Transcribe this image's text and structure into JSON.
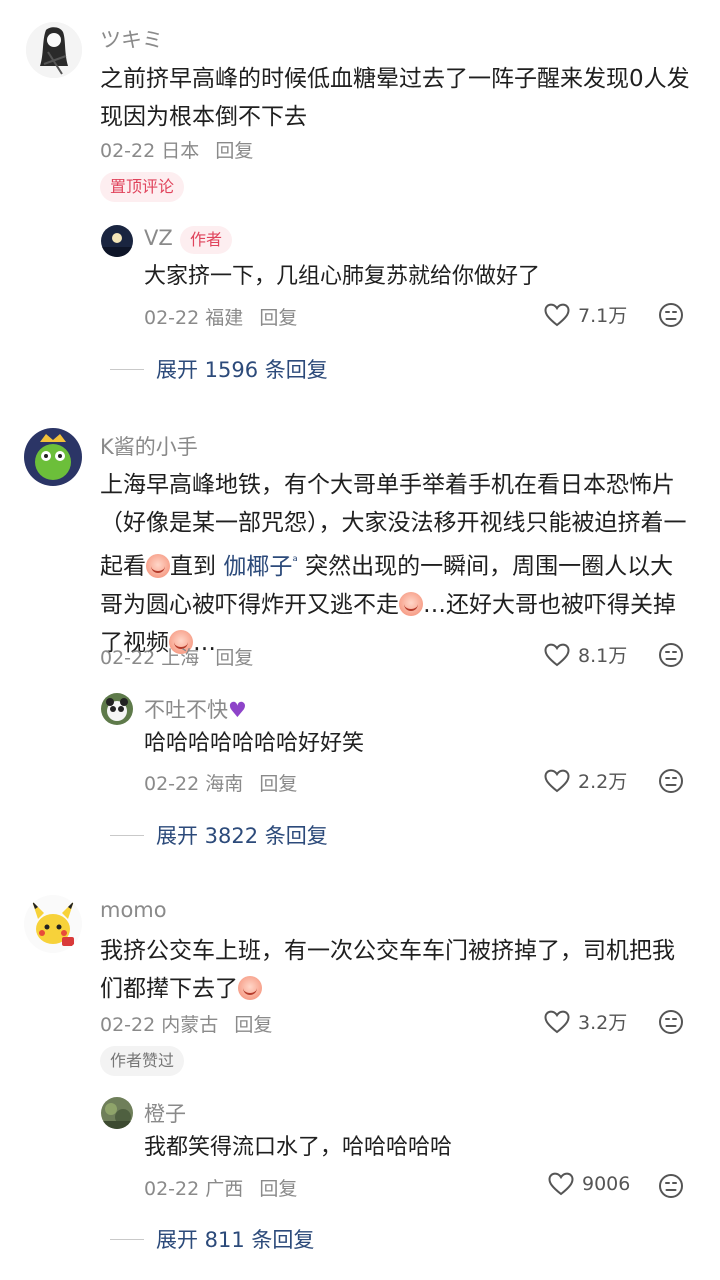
{
  "threads": [
    {
      "user": "ツキミ",
      "text": "之前挤早高峰的时候低血糖晕过去了一阵子醒来发现0人发现因为根本倒不下去",
      "date": "02-22",
      "location": "日本",
      "reply_label": "回复",
      "pin_tag": "置顶评论",
      "reply": {
        "user": "VZ",
        "author_tag": "作者",
        "text": "大家挤一下，几组心肺复苏就给你做好了",
        "date": "02-22",
        "location": "福建",
        "reply_label": "回复",
        "likes": "7.1万"
      },
      "expand": "展开 1596 条回复"
    },
    {
      "user": "K酱的小手",
      "text_part1": "上海早高峰地铁，有个大哥单手举着手机在看日本恐怖片（好像是某一部咒怨），大家没法移开视线只能被迫挤着一起看",
      "text_part2": "直到 ",
      "mention": "伽椰子",
      "text_part3": " 突然出现的一瞬间，周围一圈人以大哥为圆心被吓得炸开又逃不走",
      "text_part4": "…还好大哥也被吓得关掉了视频",
      "text_part5": "…",
      "date": "02-22",
      "location": "上海",
      "reply_label": "回复",
      "likes": "8.1万",
      "reply": {
        "user": "不吐不快",
        "text": "哈哈哈哈哈哈哈好好笑",
        "date": "02-22",
        "location": "海南",
        "reply_label": "回复",
        "likes": "2.2万"
      },
      "expand": "展开 3822 条回复"
    },
    {
      "user": "momo",
      "text": "我挤公交车上班，有一次公交车车门被挤掉了，司机把我们都撵下去了",
      "date": "02-22",
      "location": "内蒙古",
      "reply_label": "回复",
      "likes": "3.2万",
      "liked_tag": "作者赞过",
      "reply": {
        "user": "橙子",
        "text": "我都笑得流口水了，哈哈哈哈哈",
        "date": "02-22",
        "location": "广西",
        "reply_label": "回复",
        "likes": "9006"
      },
      "expand": "展开 811 条回复"
    }
  ],
  "icons": {
    "like": "heart-outline-icon",
    "dislike": "dislike-face-icon",
    "emoji": "crying-emoji-icon",
    "mention_marker": "search-link-icon",
    "heart": "purple-heart-icon"
  },
  "colors": {
    "link": "#2c4a7a",
    "pin": "#e0445c",
    "meta": "#8a8a8a"
  }
}
